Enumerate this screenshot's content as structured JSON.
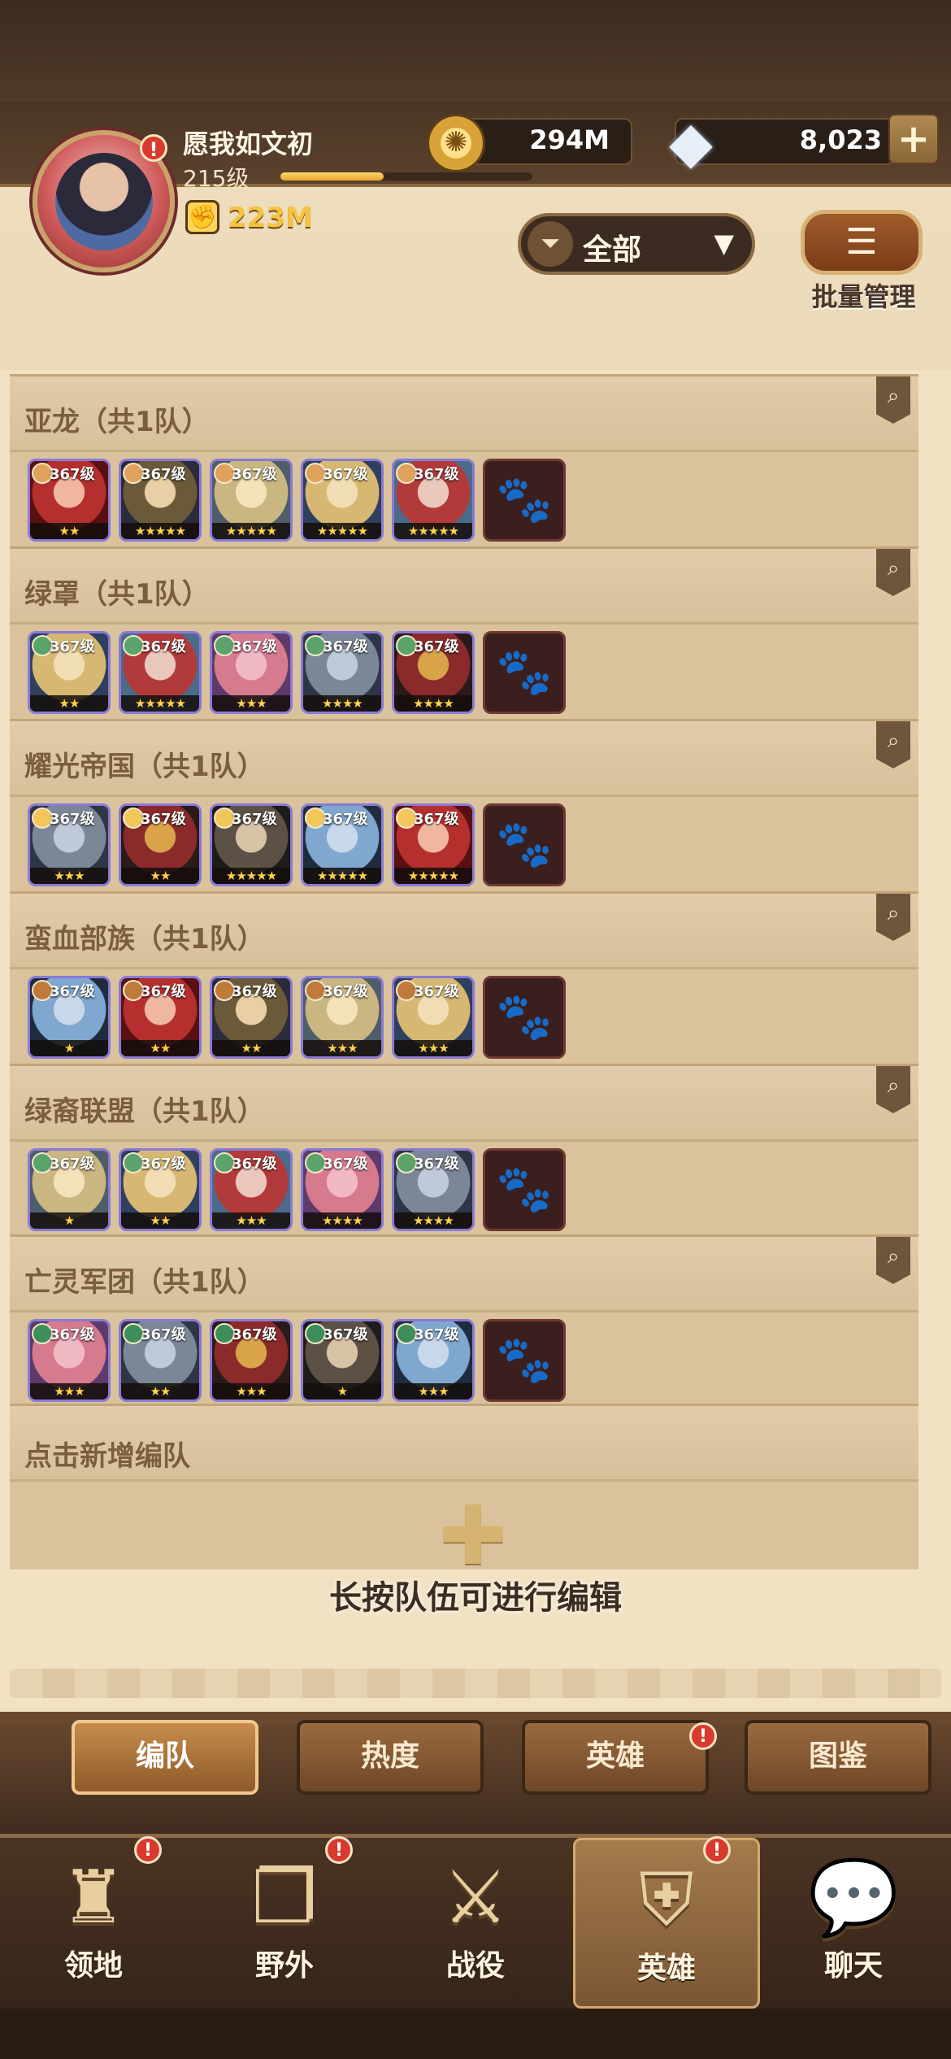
{
  "profile": {
    "name": "愿我如文初",
    "level": "215级",
    "power": "223M",
    "xp_fraction": 0.41
  },
  "currency": {
    "gold": "294M",
    "diamonds": "8,023",
    "plus": "+"
  },
  "filter": {
    "label": "全部",
    "caret": "▼"
  },
  "batch": {
    "label": "批量管理"
  },
  "factions": [
    {
      "title": "亚龙（共1队）"
    },
    {
      "title": "绿罩（共1队）"
    },
    {
      "title": "耀光帝国（共1队）"
    },
    {
      "title": "蛮血部族（共1队）"
    },
    {
      "title": "绿裔联盟（共1队）"
    },
    {
      "title": "亡灵军团（共1队）"
    }
  ],
  "hero_level": "367级",
  "new_team": {
    "title": "点击新增编队",
    "plus": "✚"
  },
  "hint": "长按队伍可进行编辑",
  "subtabs": [
    "编队",
    "热度",
    "英雄",
    "图鉴"
  ],
  "nav": [
    "领地",
    "野外",
    "战役",
    "英雄",
    "聊天"
  ],
  "colors": {
    "accent_gold": "#f4c342",
    "badge_red": "#d83a2e",
    "frame_purple": "#8a7ad6"
  }
}
